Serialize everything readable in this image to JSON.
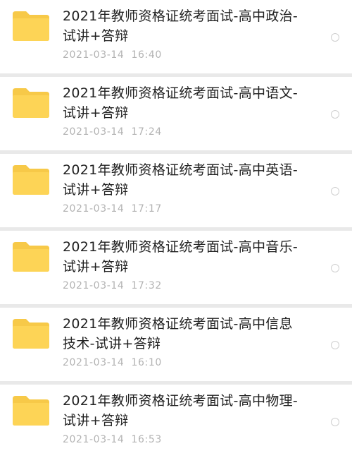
{
  "files": [
    {
      "name": "2021年教师资格证统考面试-高中政治-试讲+答辩",
      "date": "2021-03-14",
      "time": "16:40",
      "icon": "folder-icon"
    },
    {
      "name": "2021年教师资格证统考面试-高中语文-试讲+答辩",
      "date": "2021-03-14",
      "time": "17:24",
      "icon": "folder-icon"
    },
    {
      "name": "2021年教师资格证统考面试-高中英语-试讲+答辩",
      "date": "2021-03-14",
      "time": "17:17",
      "icon": "folder-icon"
    },
    {
      "name": "2021年教师资格证统考面试-高中音乐-试讲+答辩",
      "date": "2021-03-14",
      "time": "17:32",
      "icon": "folder-icon"
    },
    {
      "name": "2021年教师资格证统考面试-高中信息技术-试讲+答辩",
      "date": "2021-03-14",
      "time": "16:10",
      "icon": "folder-icon"
    },
    {
      "name": "2021年教师资格证统考面试-高中物理-试讲+答辩",
      "date": "2021-03-14",
      "time": "16:53",
      "icon": "folder-icon"
    }
  ],
  "colors": {
    "folder_back": "#f7c948",
    "folder_front": "#fdd456",
    "title_text": "#222222",
    "meta_text": "#b3b3b3",
    "separator": "#e9e9e9"
  }
}
